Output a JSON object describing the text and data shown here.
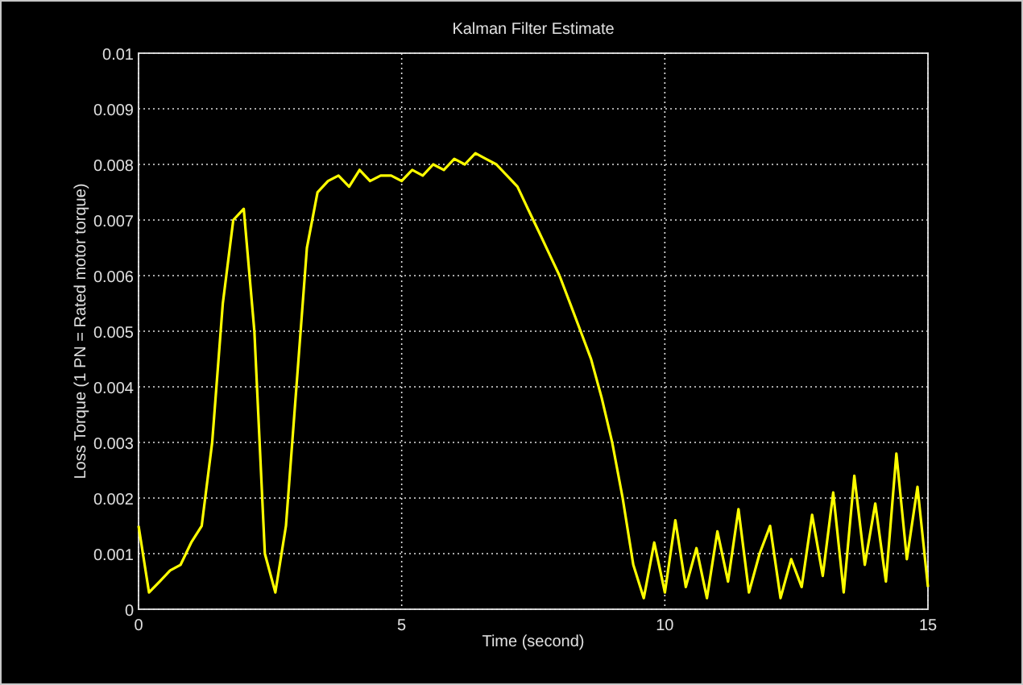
{
  "figure": {
    "chart_data": {
      "type": "line",
      "title": "Kalman Filter Estimate",
      "xlabel": "Time (second)",
      "ylabel": "Loss Torque (1 PN = Rated motor torque)",
      "x": [
        0,
        0.2,
        0.4,
        0.6,
        0.8,
        1,
        1.2,
        1.4,
        1.6,
        1.8,
        2,
        2.2,
        2.4,
        2.6,
        2.8,
        3,
        3.2,
        3.4,
        3.6,
        3.8,
        4,
        4.2,
        4.4,
        4.6,
        4.8,
        5,
        5.2,
        5.4,
        5.6,
        5.8,
        6,
        6.2,
        6.4,
        6.6,
        6.8,
        7,
        7.2,
        7.4,
        7.6,
        7.8,
        8,
        8.2,
        8.4,
        8.6,
        8.8,
        9,
        9.2,
        9.4,
        9.6,
        9.8,
        10,
        10.2,
        10.4,
        10.6,
        10.8,
        11,
        11.2,
        11.4,
        11.6,
        11.8,
        12,
        12.2,
        12.4,
        12.6,
        12.8,
        13,
        13.2,
        13.4,
        13.6,
        13.8,
        14,
        14.2,
        14.4,
        14.6,
        14.8,
        15
      ],
      "grid": true,
      "series": [
        {
          "color": "#ffff00",
          "values": [
            0.0015,
            0.0003,
            0.0005,
            0.0007,
            0.0008,
            0.0012,
            0.0015,
            0.003,
            0.0055,
            0.007,
            0.0072,
            0.005,
            0.001,
            0.0003,
            0.0015,
            0.004,
            0.0065,
            0.0075,
            0.0077,
            0.0078,
            0.0076,
            0.0079,
            0.0077,
            0.0078,
            0.0078,
            0.0077,
            0.0079,
            0.0078,
            0.008,
            0.0079,
            0.0081,
            0.008,
            0.0082,
            0.0081,
            0.008,
            0.0078,
            0.0076,
            0.0072,
            0.0068,
            0.0064,
            0.006,
            0.0055,
            0.005,
            0.0045,
            0.0038,
            0.003,
            0.002,
            0.0008,
            0.0002,
            0.0012,
            0.0003,
            0.0016,
            0.0004,
            0.0011,
            0.0002,
            0.0014,
            0.0005,
            0.0018,
            0.0003,
            0.001,
            0.0015,
            0.0002,
            0.0009,
            0.0004,
            0.0017,
            0.0006,
            0.0021,
            0.0003,
            0.0024,
            0.0008,
            0.0019,
            0.0005,
            0.0028,
            0.0009,
            0.0022,
            0.0004
          ]
        }
      ],
      "xlim": [
        0,
        15
      ],
      "ylim": [
        0,
        0.01
      ],
      "xticks": [
        0,
        5,
        10,
        15
      ],
      "yticks": [
        0,
        0.001,
        0.002,
        0.003,
        0.004,
        0.005,
        0.006,
        0.007,
        0.008,
        0.009,
        0.01
      ]
    }
  }
}
